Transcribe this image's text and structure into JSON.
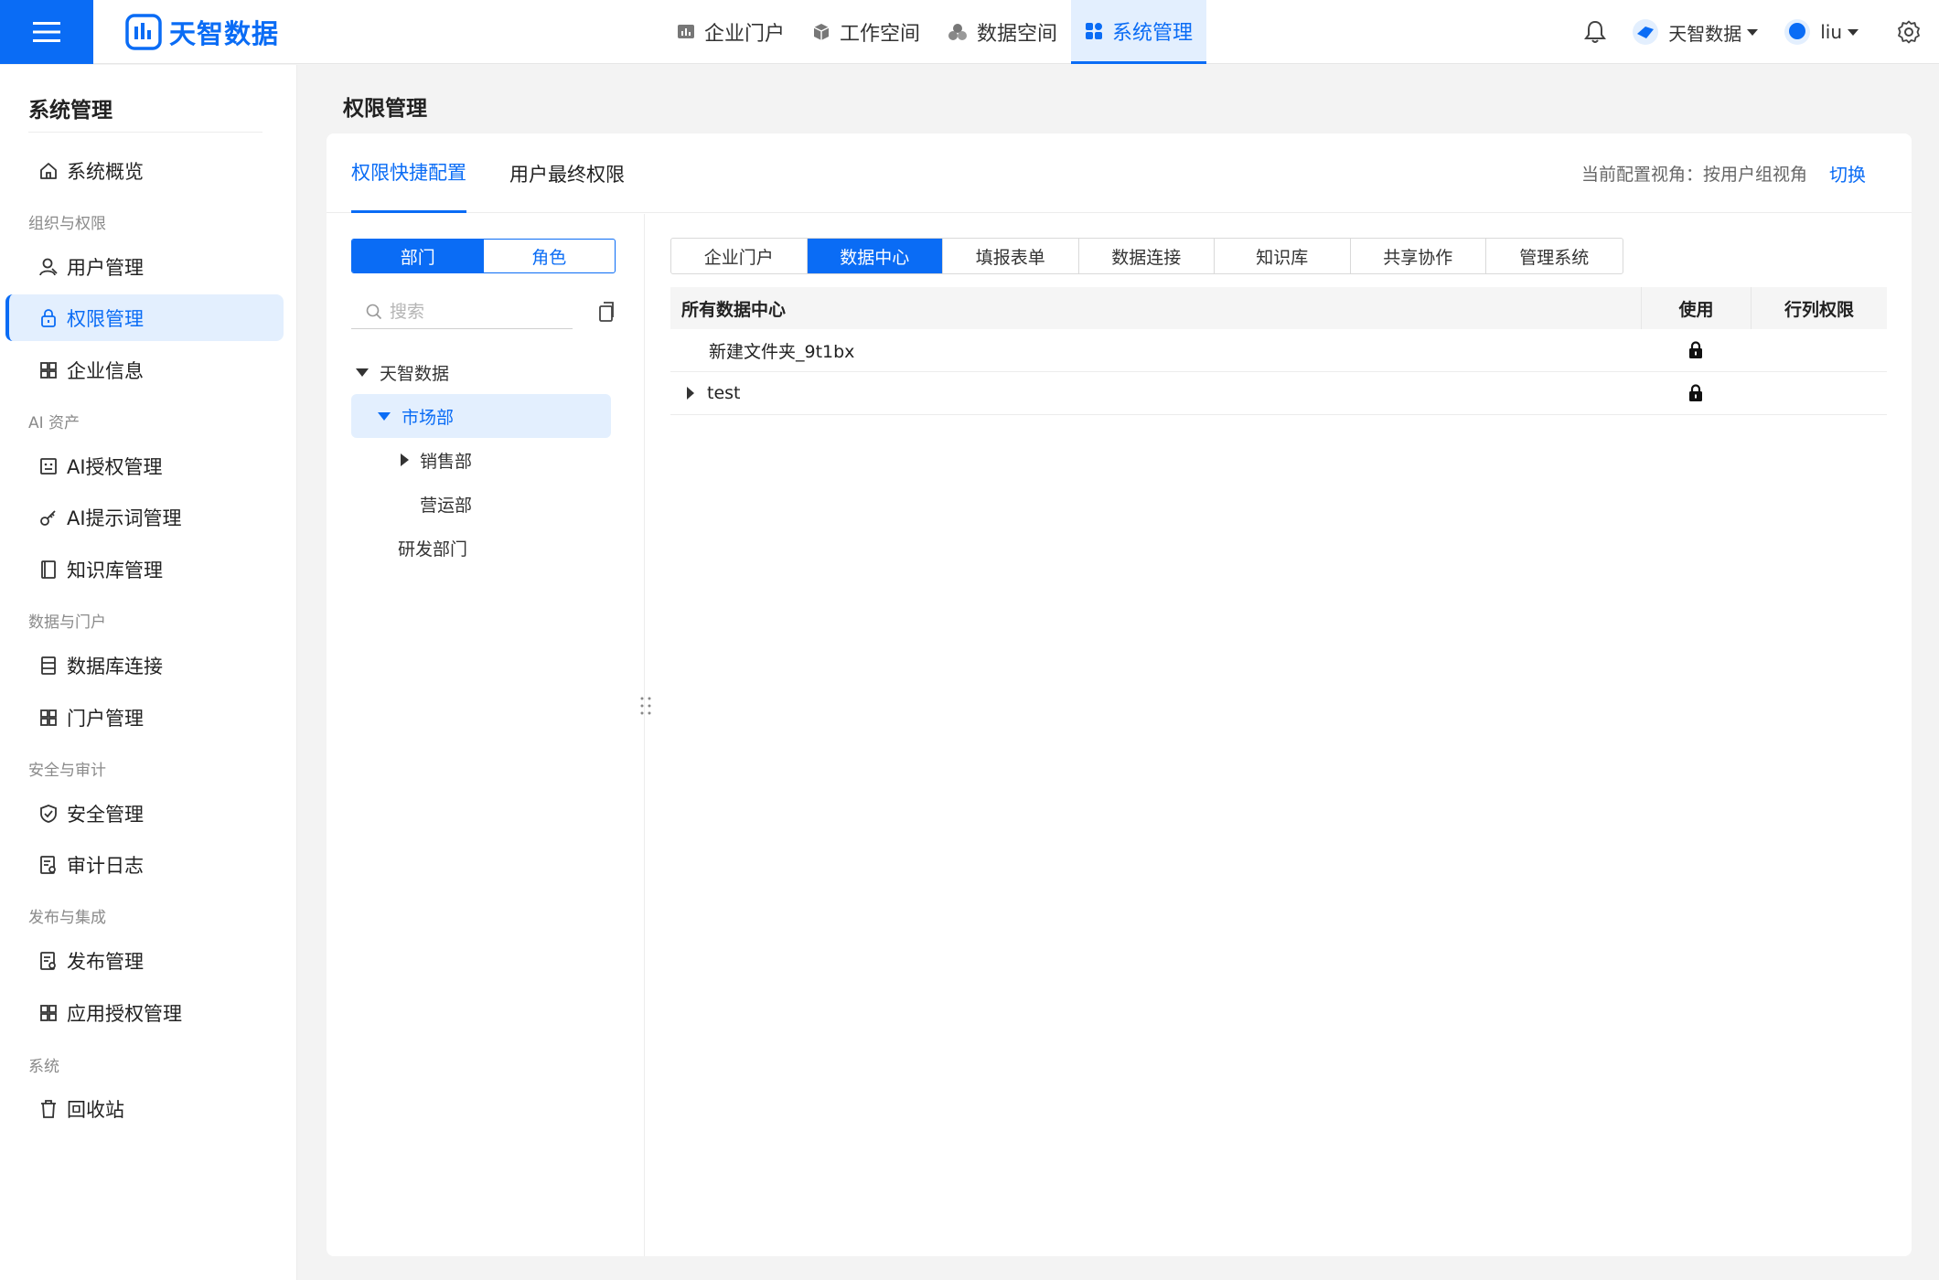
{
  "header": {
    "logo_text": "天智数据",
    "nav": [
      {
        "label": "企业门户",
        "icon": "chart-icon"
      },
      {
        "label": "工作空间",
        "icon": "cube-icon"
      },
      {
        "label": "数据空间",
        "icon": "cluster-icon"
      },
      {
        "label": "系统管理",
        "icon": "grid-icon",
        "active": true
      }
    ],
    "org_name": "天智数据",
    "user_name": "liu"
  },
  "sidebar": {
    "title": "系统管理",
    "groups": {
      "org": "组织与权限",
      "ai": "AI 资产",
      "data": "数据与门户",
      "security": "安全与审计",
      "publish": "发布与集成",
      "system": "系统"
    },
    "items": {
      "overview": "系统概览",
      "users": "用户管理",
      "permissions": "权限管理",
      "enterprise": "企业信息",
      "ai_auth": "AI授权管理",
      "ai_prompts": "AI提示词管理",
      "kb": "知识库管理",
      "db_conn": "数据库连接",
      "portal": "门户管理",
      "security": "安全管理",
      "audit": "审计日志",
      "release": "发布管理",
      "app_auth": "应用授权管理",
      "recycle": "回收站"
    }
  },
  "page": {
    "title": "权限管理",
    "tabs": [
      "权限快捷配置",
      "用户最终权限"
    ],
    "view_label": "当前配置视角：按用户组视角",
    "switch_label": "切换"
  },
  "left_panel": {
    "segments": [
      "部门",
      "角色"
    ],
    "search_placeholder": "搜索",
    "tree": {
      "root": "天智数据",
      "market": "市场部",
      "sales": "销售部",
      "ops": "营运部",
      "rd": "研发部门"
    }
  },
  "right_panel": {
    "type_tabs": [
      "企业门户",
      "数据中心",
      "填报表单",
      "数据连接",
      "知识库",
      "共享协作",
      "管理系统"
    ],
    "active_type": "数据中心",
    "table": {
      "headers": [
        "所有数据中心",
        "使用",
        "行列权限"
      ],
      "rows": [
        {
          "name": "新建文件夹_9t1bx",
          "use": "lock-icon",
          "expandable": false
        },
        {
          "name": "test",
          "use": "lock-icon",
          "expandable": true
        }
      ]
    }
  },
  "colors": {
    "primary": "#0a6cf5",
    "active_bg": "#e3effe"
  }
}
